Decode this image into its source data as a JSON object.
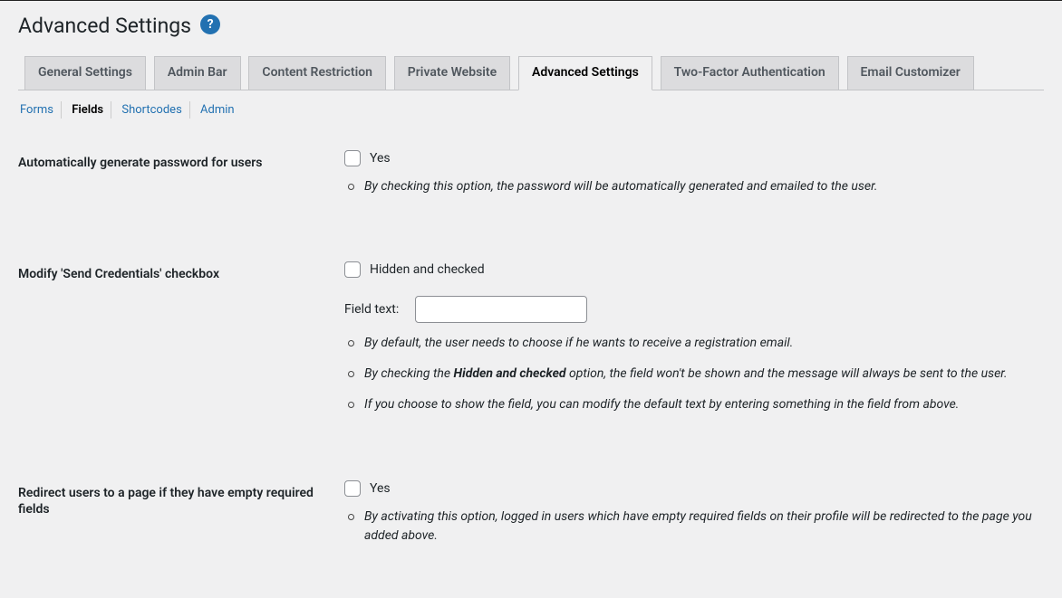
{
  "page": {
    "title": "Advanced Settings"
  },
  "tabs": [
    {
      "label": "General Settings",
      "active": false
    },
    {
      "label": "Admin Bar",
      "active": false
    },
    {
      "label": "Content Restriction",
      "active": false
    },
    {
      "label": "Private Website",
      "active": false
    },
    {
      "label": "Advanced Settings",
      "active": true
    },
    {
      "label": "Two-Factor Authentication",
      "active": false
    },
    {
      "label": "Email Customizer",
      "active": false
    }
  ],
  "subtabs": [
    {
      "label": "Forms",
      "active": false
    },
    {
      "label": "Fields",
      "active": true
    },
    {
      "label": "Shortcodes",
      "active": false
    },
    {
      "label": "Admin",
      "active": false
    }
  ],
  "settings": {
    "auto_password": {
      "label": "Automatically generate password for users",
      "checkbox_label": "Yes",
      "checked": false,
      "description": [
        "By checking this option, the password will be automatically generated and emailed to the user."
      ]
    },
    "send_credentials": {
      "label": "Modify 'Send Credentials' checkbox",
      "checkbox_label": "Hidden and checked",
      "checked": false,
      "field_text_label": "Field text:",
      "field_text_value": "",
      "desc_prefix_1": "By default, the user needs to choose if he wants to receive a registration email.",
      "desc_prefix_2a": "By checking the ",
      "desc_bold_2": "Hidden and checked",
      "desc_suffix_2b": " option, the field won't be shown and the message will always be sent to the user.",
      "desc_prefix_3": "If you choose to show the field, you can modify the default text by entering something in the field from above."
    },
    "redirect_empty": {
      "label": "Redirect users to a page if they have empty required fields",
      "checkbox_label": "Yes",
      "checked": false,
      "description": [
        "By activating this option, logged in users which have empty required fields on their profile will be redirected to the page you added above."
      ]
    }
  }
}
